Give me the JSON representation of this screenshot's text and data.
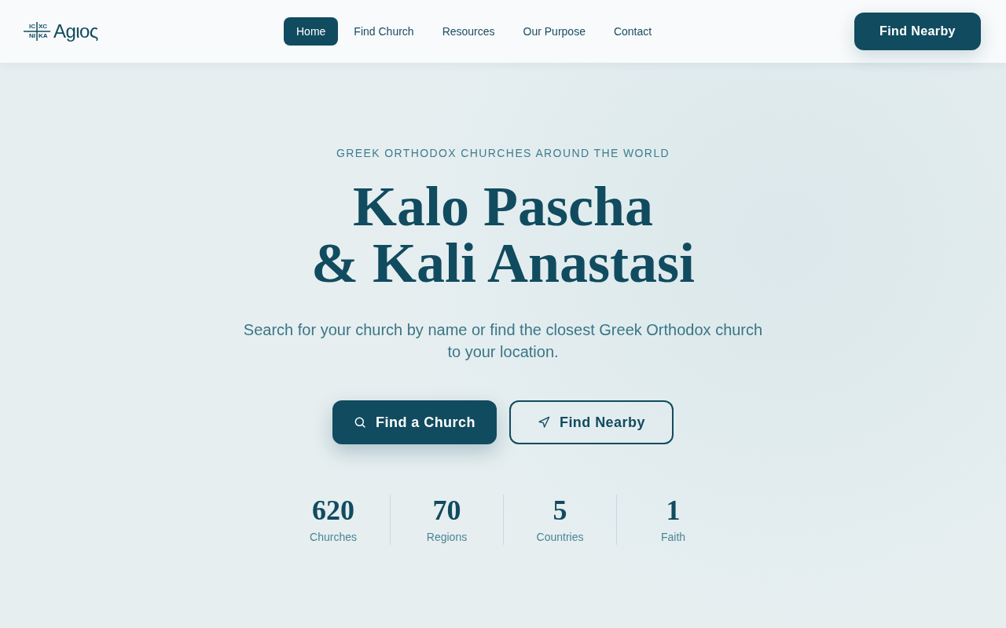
{
  "header": {
    "logo": {
      "cross_letters": [
        "IC",
        "XC",
        "NI",
        "KA"
      ],
      "wordmark": "Agιος"
    },
    "nav": [
      {
        "label": "Home",
        "selected": true
      },
      {
        "label": "Find Church",
        "selected": false
      },
      {
        "label": "Resources",
        "selected": false
      },
      {
        "label": "Our Purpose",
        "selected": false
      },
      {
        "label": "Contact",
        "selected": false
      }
    ],
    "cta": "Find Nearby"
  },
  "hero": {
    "eyebrow": "GREEK ORTHODOX CHURCHES AROUND THE WORLD",
    "title_lines": [
      "Kalo Pascha",
      "& Kali Anastasi"
    ],
    "subtitle": "Search for your church by name or find the closest Greek Orthodox church to your location.",
    "buttons": [
      {
        "label": "Find a Church",
        "kind": "primary"
      },
      {
        "label": "Find Nearby",
        "kind": "outline"
      }
    ]
  },
  "stats": [
    {
      "value": "620",
      "label": "Churches"
    },
    {
      "value": "70",
      "label": "Regions"
    },
    {
      "value": "5",
      "label": "Countries"
    },
    {
      "value": "1",
      "label": "Faith"
    }
  ]
}
